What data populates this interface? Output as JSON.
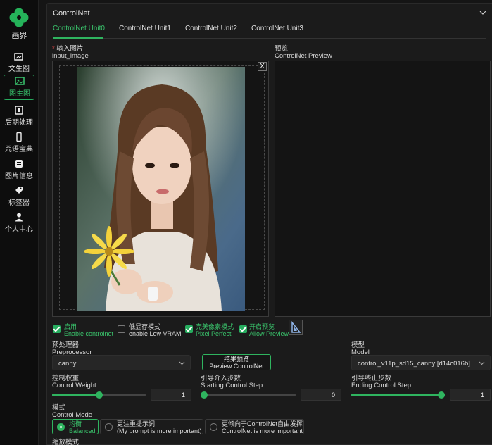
{
  "sidebar": {
    "logo_text": "画界",
    "items": [
      {
        "label": "文生图",
        "icon": "image-text-icon"
      },
      {
        "label": "图生图",
        "icon": "image-icon",
        "active": true
      },
      {
        "label": "后期处理",
        "icon": "postprocess-icon"
      },
      {
        "label": "咒语宝典",
        "icon": "phone-book-icon"
      },
      {
        "label": "图片信息",
        "icon": "layers-icon"
      },
      {
        "label": "标签器",
        "icon": "tag-icon"
      },
      {
        "label": "个人中心",
        "icon": "user-icon"
      }
    ]
  },
  "panel": {
    "title": "ControlNet",
    "tabs": [
      "ControlNet Unit0",
      "ControlNet Unit1",
      "ControlNet Unit2",
      "ControlNet Unit3"
    ],
    "active_tab": 0,
    "input_image": {
      "required_mark": "*",
      "label_cn": "输入图片",
      "label_en": "input_image",
      "close": "X"
    },
    "preview": {
      "label_cn": "预览",
      "label_en": "ControlNet Preview"
    },
    "checks": [
      {
        "cn": "启用",
        "en": "Enable controlnet",
        "checked": true
      },
      {
        "cn": "低显存模式",
        "en": "enable Low VRAM",
        "checked": false
      },
      {
        "cn": "完美像素模式",
        "en": "Pixel Perfect",
        "checked": true
      },
      {
        "cn": "开启预览",
        "en": "Allow Preview",
        "checked": true
      }
    ],
    "preprocessor": {
      "cn": "预处理器",
      "en": "Preprocessor",
      "value": "canny"
    },
    "preview_button": {
      "cn": "结果预览",
      "en": "Preview ControlNet"
    },
    "model": {
      "cn": "模型",
      "en": "Model",
      "value": "control_v11p_sd15_canny [d14c016b]"
    },
    "control_weight": {
      "cn": "控制权重",
      "en": "Control Weight",
      "value": "1",
      "fraction": 0.5
    },
    "starting_step": {
      "cn": "引导介入步数",
      "en": "Starting Control Step",
      "value": "0",
      "fraction": 0.0
    },
    "ending_step": {
      "cn": "引导终止步数",
      "en": "Ending Control Step",
      "value": "1",
      "fraction": 1.0
    },
    "control_mode": {
      "cn": "模式",
      "en": "Control Mode",
      "options": [
        {
          "cn": "均衡",
          "en": "Balanced",
          "selected": true
        },
        {
          "cn": "更注重提示词",
          "en": "(My prompt is more important)",
          "selected": false
        },
        {
          "cn": "更倾向于ControlNet自由发挥",
          "en": "ControlNet is more important",
          "selected": false
        }
      ]
    },
    "resize_mode_cn": "缩放模式"
  },
  "colors": {
    "accent": "#2fb45f",
    "background": "#1b1b1b",
    "sidebar": "#0d0d0d"
  }
}
